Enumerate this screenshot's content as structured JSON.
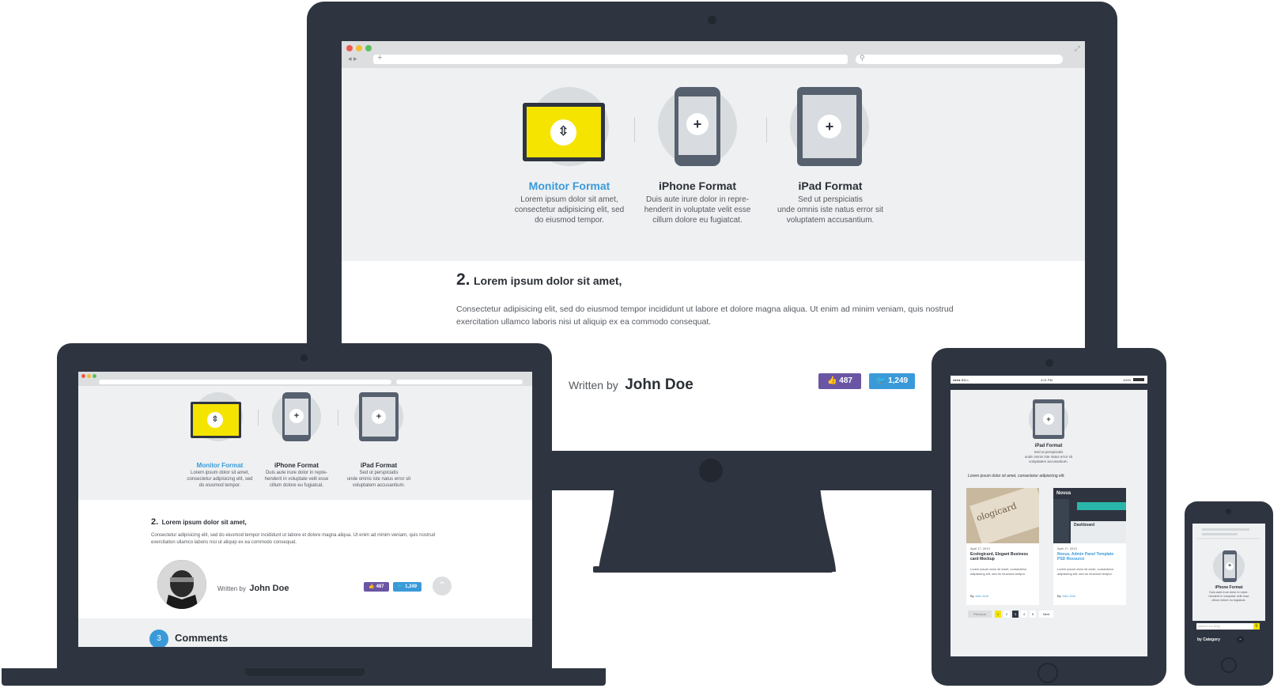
{
  "features": [
    {
      "title": "Monitor Format",
      "desc": [
        "Lorem ipsum dolor sit amet,",
        "consectetur adipisicing elit, sed",
        "do eiusmod tempor."
      ],
      "active": true
    },
    {
      "title": "iPhone Format",
      "desc": [
        "Duis aute irure dolor in repre-",
        "henderit in voluptate velit esse",
        "cillum dolore eu fugiatcat."
      ],
      "active": false
    },
    {
      "title": "iPad Format",
      "desc": [
        "Sed ut perspiciatis",
        "unde omnis iste natus error sit",
        "voluptatem accusantium."
      ],
      "active": false
    }
  ],
  "article": {
    "number": "2.",
    "heading": "Lorem ipsum dolor sit amet,",
    "body_line1": "Consectetur adipisicing elit, sed do eiusmod tempor incididunt ut labore et dolore magna aliqua. Ut enim ad minim veniam, quis nostrud",
    "body_line2": "exercitation ullamco laboris nisi ut aliquip ex ea commodo consequat."
  },
  "author": {
    "written_by": "Written by",
    "name": "John Doe"
  },
  "social": {
    "likes": "487",
    "tweets": "1,249"
  },
  "comments": {
    "count": "3",
    "label": "Comments"
  },
  "tablet": {
    "status_carrier": "●●●● BELL ",
    "status_time": "4:21 PM",
    "status_battery": "100%",
    "feature_title": "iPad Format",
    "feature_desc": [
      "Sed ut perspiciatis",
      "unde omnis iste natus error sit",
      "voluptatem accusantium."
    ],
    "intro": "Lorem ipsum dolor sit amet, consectetur adipisicing elit.",
    "cards": [
      {
        "image_text": "ologicard",
        "date": "April 17, 2013",
        "title": "Ecologicard, Elegant Business card Mockup",
        "body": "Lorem ipsum dolor sit amet, consectetur adipisicing elit, sed do eiusmod tempor.",
        "by": "By",
        "author": "John Doe"
      },
      {
        "image_text": "Novus",
        "date": "April 17, 2013",
        "title": "Novus, Admin Panel Template PSD Resource",
        "body": "Lorem ipsum dolor sit amet, consectetur adipisicing elit, sed do eiusmod tempor.",
        "by": "By",
        "author": "John Doe"
      }
    ],
    "pagination": {
      "prev": "Previous",
      "pages": [
        "1",
        "2",
        "3",
        "4",
        "5"
      ],
      "next": "Next"
    }
  },
  "phone": {
    "feature_title": "iPhone Format",
    "feature_desc": [
      "Duis aute irure dolor in repre-",
      "henderit in voluptate velit esse",
      "cillum dolore eu fugiatcat."
    ],
    "search_placeholder": "search our blog",
    "category_label": "by Category"
  },
  "colors": {
    "accent": "#3a9ad9",
    "like": "#6a55a5",
    "twitter": "#3a9ad9",
    "device": "#2f3540",
    "yellow": "#f5e400"
  }
}
